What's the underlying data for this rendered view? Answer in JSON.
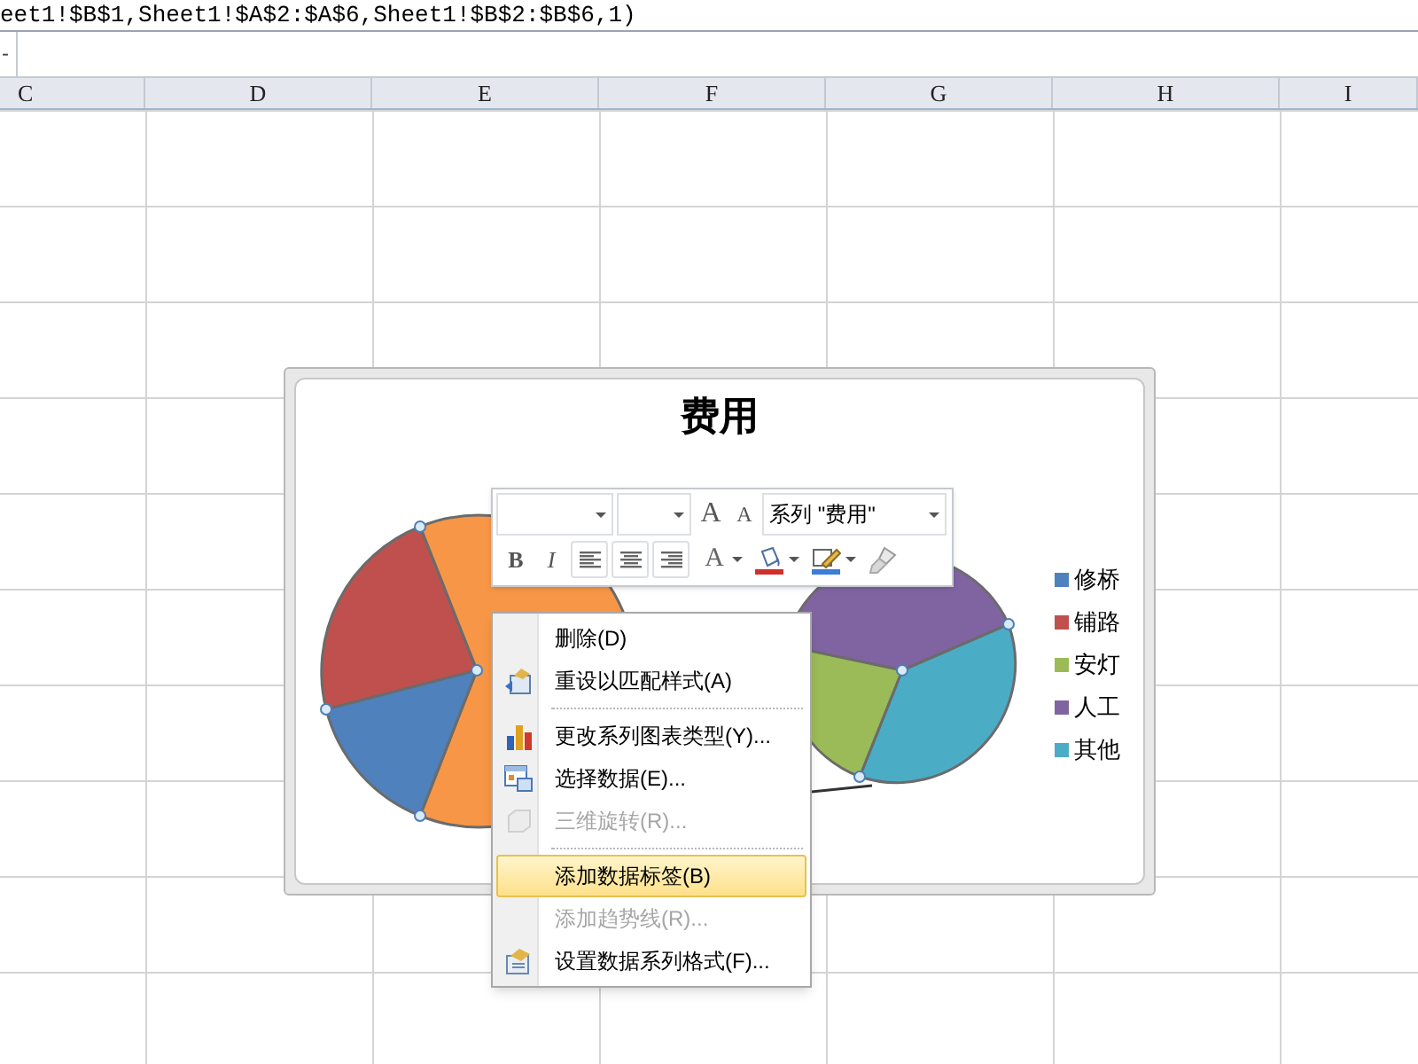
{
  "formula_bar": {
    "text": "eet1!$B$1,Sheet1!$A$2:$A$6,Sheet1!$B$2:$B$6,1)"
  },
  "name_box": {
    "text": "-"
  },
  "column_headers": [
    "C",
    "D",
    "E",
    "F",
    "G",
    "H",
    "I"
  ],
  "chart": {
    "title": "费用",
    "legend": [
      {
        "label": "修桥",
        "color": "#4f81bd"
      },
      {
        "label": "铺路",
        "color": "#c0504d"
      },
      {
        "label": "安灯",
        "color": "#9bbb59"
      },
      {
        "label": "人工",
        "color": "#8064a2"
      },
      {
        "label": "其他",
        "color": "#4bacc6"
      }
    ]
  },
  "mini_toolbar": {
    "grow_font": "A",
    "shrink_font": "A",
    "series_selector": "系列 \"费用\"",
    "bold": "B",
    "italic": "I",
    "font_color": "A"
  },
  "context_menu": {
    "items": [
      {
        "kind": "item",
        "label": "删除(D)",
        "disabled": false,
        "selected": false
      },
      {
        "kind": "item",
        "label": "重设以匹配样式(A)",
        "disabled": false,
        "selected": false
      },
      {
        "kind": "separator"
      },
      {
        "kind": "item",
        "label": "更改系列图表类型(Y)...",
        "disabled": false,
        "selected": false
      },
      {
        "kind": "item",
        "label": "选择数据(E)...",
        "disabled": false,
        "selected": false
      },
      {
        "kind": "item",
        "label": "三维旋转(R)...",
        "disabled": true,
        "selected": false
      },
      {
        "kind": "separator"
      },
      {
        "kind": "item",
        "label": "添加数据标签(B)",
        "disabled": false,
        "selected": true
      },
      {
        "kind": "item",
        "label": "添加趋势线(R)...",
        "disabled": true,
        "selected": false
      },
      {
        "kind": "item",
        "label": "设置数据系列格式(F)...",
        "disabled": false,
        "selected": false
      }
    ]
  }
}
